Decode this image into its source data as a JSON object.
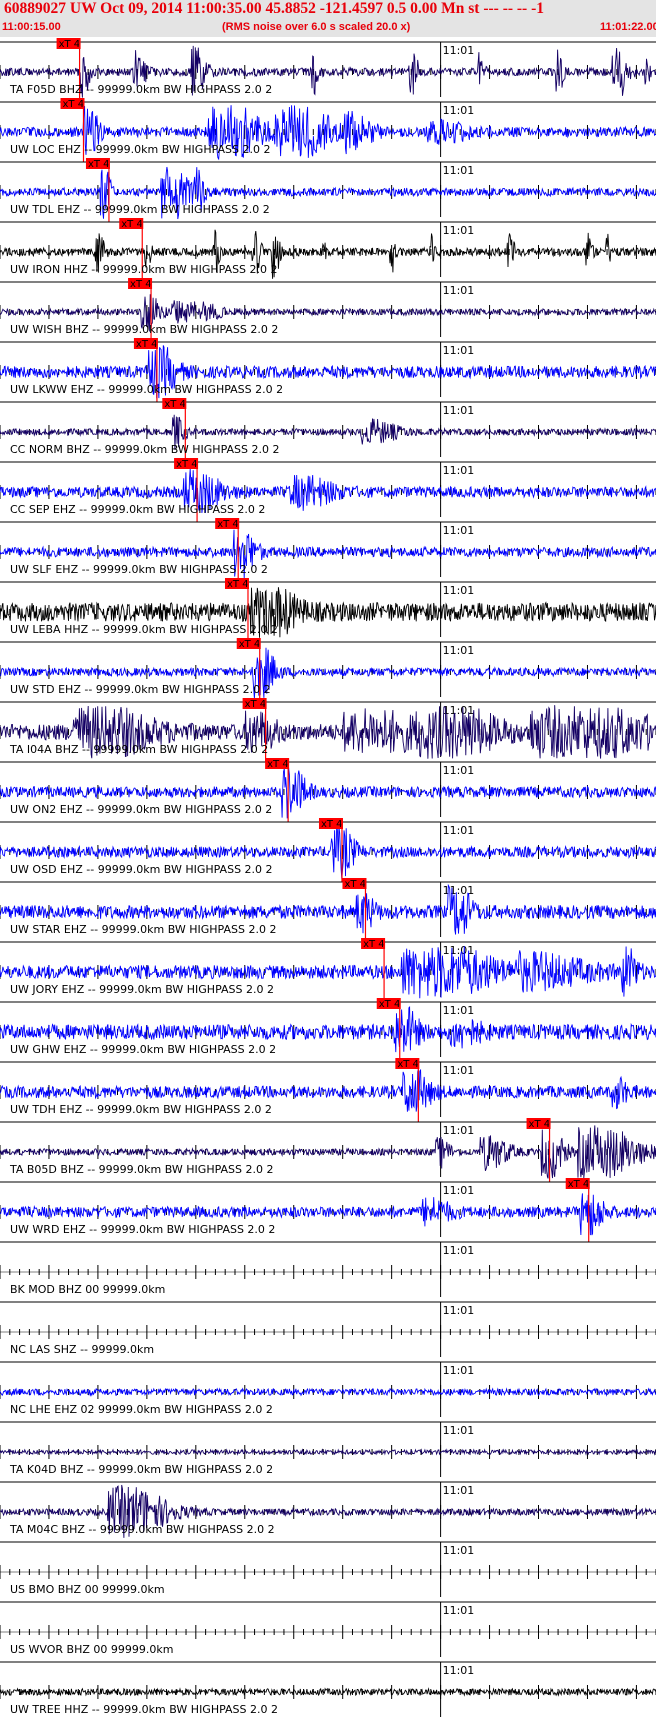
{
  "header": {
    "title": "60889027 UW Oct 09, 2014 11:00:35.00   45.8852 -121.4597  0.5 0.00 Mn st --- -- --  -1",
    "start_time": "11:00:15.00",
    "rms_note": "(RMS noise over 6.0 s scaled 20.0 x)",
    "end_time": "11:01:22.00",
    "minute_mark_label": "11:01",
    "pick_label": "xT 4"
  },
  "colors": {
    "title": "#e8000a",
    "pick": "#ff0000",
    "trace_blue": "#0000ff",
    "trace_navy": "#140064",
    "trace_black": "#000000",
    "header_bg": "#e4e4e4"
  },
  "chart_data": {
    "type": "seismogram-section",
    "time_start": "11:00:15.00",
    "time_end": "11:01:22.00",
    "minute_mark": "11:01",
    "traces": [
      {
        "label": "TA F05D BHZ -- 99999.0km BW  HIGHPASS  2.0  2",
        "color": "#140064",
        "pick": "xT 4",
        "pick_s": 6.8,
        "noise": 0.15,
        "bursts": [
          [
            8.5,
            0.6,
            1.0
          ],
          [
            14,
            0.8,
            0.7
          ],
          [
            20,
            1.0,
            0.9
          ],
          [
            32,
            0.5,
            0.8
          ],
          [
            42,
            0.6,
            0.9
          ],
          [
            49,
            0.4,
            0.7
          ],
          [
            57,
            0.5,
            0.9
          ],
          [
            63,
            1.0,
            1.0
          ],
          [
            66,
            0.3,
            0.6
          ]
        ]
      },
      {
        "label": "UW LOC EHZ -- 99999.0km BW  HIGHPASS  2.0  2",
        "color": "#0000ff",
        "pick": "xT 4",
        "pick_s": 7.2,
        "noise": 0.18,
        "bursts": [
          [
            9,
            1.0,
            0.9
          ],
          [
            23,
            3.5,
            1.0
          ],
          [
            30,
            4.0,
            1.0
          ],
          [
            36,
            2.0,
            0.5
          ],
          [
            45,
            3.0,
            0.3
          ]
        ]
      },
      {
        "label": "UW TDL EHZ -- 99999.0km BW  HIGHPASS  2.0  2",
        "color": "#0000ff",
        "pick": "xT 4",
        "pick_s": 9.8,
        "noise": 0.15,
        "bursts": [
          [
            10.5,
            0.7,
            1.0
          ],
          [
            17,
            1.2,
            1.0
          ],
          [
            18.5,
            1.0,
            1.0
          ],
          [
            20,
            0.8,
            0.9
          ]
        ]
      },
      {
        "label": "UW IRON HHZ -- 99999.0km BW  HIGHPASS  2.0  2",
        "color": "#000000",
        "pick": "xT 4",
        "pick_s": 13.2,
        "noise": 0.15,
        "bursts": [
          [
            10,
            0.6,
            0.7
          ],
          [
            15,
            0.4,
            0.6
          ],
          [
            22,
            0.4,
            0.7
          ],
          [
            26,
            0.6,
            0.8
          ],
          [
            28,
            0.5,
            1.0
          ],
          [
            33,
            0.3,
            0.7
          ],
          [
            40,
            0.4,
            0.7
          ],
          [
            44,
            0.3,
            0.7
          ],
          [
            52,
            0.5,
            0.6
          ],
          [
            60,
            0.4,
            0.7
          ],
          [
            62,
            0.3,
            0.6
          ]
        ]
      },
      {
        "label": "UW WISH BHZ -- 99999.0km BW  HIGHPASS  2.0  2",
        "color": "#140064",
        "pick": "xT 4",
        "pick_s": 14.1,
        "noise": 0.12,
        "bursts": [
          [
            15,
            1.2,
            0.7
          ],
          [
            19,
            3.0,
            0.4
          ]
        ]
      },
      {
        "label": "UW LKWW EHZ -- 99999.0km BW  HIGHPASS  2.0  2",
        "color": "#0000ff",
        "pick": "xT 4",
        "pick_s": 14.7,
        "noise": 0.22,
        "bursts": [
          [
            16,
            1.8,
            1.0
          ]
        ]
      },
      {
        "label": "CC NORM BHZ -- 99999.0km BW  HIGHPASS  2.0  2",
        "color": "#140064",
        "pick": "xT 4",
        "pick_s": 17.6,
        "noise": 0.12,
        "bursts": [
          [
            18,
            0.8,
            0.6
          ],
          [
            38,
            2.5,
            0.4
          ]
        ]
      },
      {
        "label": "CC SEP EHZ -- 99999.0km BW  HIGHPASS  2.0  2",
        "color": "#0000ff",
        "pick": "xT 4",
        "pick_s": 18.8,
        "noise": 0.2,
        "bursts": [
          [
            20,
            2.5,
            0.7
          ],
          [
            31,
            3.0,
            0.5
          ]
        ]
      },
      {
        "label": "UW SLF EHZ -- 99999.0km BW  HIGHPASS  2.0  2",
        "color": "#0000ff",
        "pick": "xT 4",
        "pick_s": 23.0,
        "noise": 0.18,
        "bursts": [
          [
            24.5,
            1.5,
            0.9
          ]
        ]
      },
      {
        "label": "UW LEBA HHZ -- 99999.0km BW  HIGHPASS  2.0  2",
        "color": "#000000",
        "pick": "xT 4",
        "pick_s": 24.0,
        "noise": 0.35,
        "bursts": [
          [
            27,
            2.8,
            1.0
          ]
        ]
      },
      {
        "label": "UW STD EHZ -- 99999.0km BW  HIGHPASS  2.0  2",
        "color": "#0000ff",
        "pick": "xT 4",
        "pick_s": 25.2,
        "noise": 0.15,
        "bursts": [
          [
            26.5,
            1.5,
            1.0
          ]
        ]
      },
      {
        "label": "TA I04A BHZ -- 99999.0km BW  HIGHPASS  2.0  2",
        "color": "#140064",
        "pick": "xT 4",
        "pick_s": 25.8,
        "noise": 0.3,
        "bursts": [
          [
            10,
            5.0,
            0.9
          ],
          [
            26,
            2.0,
            0.6
          ],
          [
            38,
            6.0,
            0.6
          ],
          [
            45,
            5.0,
            1.0
          ],
          [
            58,
            8.0,
            1.0
          ]
        ]
      },
      {
        "label": "UW ON2 EHZ -- 99999.0km BW  HIGHPASS  2.0  2",
        "color": "#0000ff",
        "pick": "xT 4",
        "pick_s": 28.1,
        "noise": 0.2,
        "bursts": [
          [
            29.5,
            1.5,
            1.0
          ]
        ]
      },
      {
        "label": "UW OSD EHZ -- 99999.0km BW  HIGHPASS  2.0  2",
        "color": "#0000ff",
        "pick": "xT 4",
        "pick_s": 33.6,
        "noise": 0.2,
        "bursts": [
          [
            34.5,
            1.5,
            1.0
          ]
        ]
      },
      {
        "label": "UW STAR EHZ -- 99999.0km BW  HIGHPASS  2.0  2",
        "color": "#0000ff",
        "pick": "xT 4",
        "pick_s": 36.0,
        "noise": 0.25,
        "bursts": [
          [
            37,
            1.2,
            0.6
          ],
          [
            46.5,
            1.5,
            1.0
          ]
        ]
      },
      {
        "label": "UW JORY EHZ -- 99999.0km BW  HIGHPASS  2.0  2",
        "color": "#0000ff",
        "pick": "xT 4",
        "pick_s": 37.9,
        "noise": 0.25,
        "bursts": [
          [
            44,
            6.0,
            1.0
          ],
          [
            55,
            5.0,
            0.5
          ],
          [
            64,
            1.0,
            0.8
          ]
        ]
      },
      {
        "label": "UW GHW EHZ -- 99999.0km BW  HIGHPASS  2.0  2",
        "color": "#0000ff",
        "pick": "xT 4",
        "pick_s": 39.5,
        "noise": 0.28,
        "bursts": [
          [
            41,
            1.5,
            0.9
          ],
          [
            47,
            2.0,
            0.4
          ]
        ]
      },
      {
        "label": "UW TDH EHZ -- 99999.0km BW  HIGHPASS  2.0  2",
        "color": "#0000ff",
        "pick": "xT 4",
        "pick_s": 41.4,
        "noise": 0.22,
        "bursts": [
          [
            42,
            1.8,
            0.8
          ],
          [
            63,
            1.0,
            0.5
          ]
        ]
      },
      {
        "label": "TA B05D BHZ -- 99999.0km BW  HIGHPASS  2.0  2",
        "color": "#140064",
        "pick": "xT 4",
        "pick_s": 54.8,
        "noise": 0.12,
        "bursts": [
          [
            45,
            1.0,
            0.5
          ],
          [
            50,
            2.0,
            0.6
          ],
          [
            56,
            1.5,
            1.0
          ],
          [
            61,
            4.0,
            1.0
          ]
        ]
      },
      {
        "label": "UW WRD EHZ -- 99999.0km BW  HIGHPASS  2.0  2",
        "color": "#0000ff",
        "pick": "xT 4",
        "pick_s": 58.8,
        "noise": 0.2,
        "bursts": [
          [
            44,
            2.0,
            0.4
          ],
          [
            60,
            1.5,
            0.8
          ]
        ]
      },
      {
        "label": "BK MOD BHZ 00 99999.0km",
        "color": "#000000",
        "pick": null,
        "pick_s": null,
        "noise": 0.0,
        "bursts": []
      },
      {
        "label": "NC LAS SHZ -- 99999.0km",
        "color": "#000000",
        "pick": null,
        "pick_s": null,
        "noise": 0.0,
        "bursts": []
      },
      {
        "label": "NC LHE EHZ 02 99999.0km BW  HIGHPASS  2.0  2",
        "color": "#0000ff",
        "pick": null,
        "pick_s": null,
        "noise": 0.12,
        "bursts": []
      },
      {
        "label": "TA K04D BHZ -- 99999.0km BW  HIGHPASS  2.0  2",
        "color": "#140064",
        "pick": null,
        "pick_s": null,
        "noise": 0.08,
        "bursts": []
      },
      {
        "label": "TA M04C BHZ -- 99999.0km BW  HIGHPASS  2.0  2",
        "color": "#140064",
        "pick": null,
        "pick_s": null,
        "noise": 0.12,
        "bursts": [
          [
            13,
            4.0,
            0.9
          ]
        ]
      },
      {
        "label": "US BMO BHZ 00 99999.0km",
        "color": "#000000",
        "pick": null,
        "pick_s": null,
        "noise": 0.0,
        "bursts": []
      },
      {
        "label": "US WVOR BHZ 00 99999.0km",
        "color": "#000000",
        "pick": null,
        "pick_s": null,
        "noise": 0.0,
        "bursts": []
      },
      {
        "label": "UW TREE HHZ -- 99999.0km BW  HIGHPASS  2.0  2",
        "color": "#000000",
        "pick": null,
        "pick_s": null,
        "noise": 0.12,
        "bursts": []
      }
    ]
  }
}
